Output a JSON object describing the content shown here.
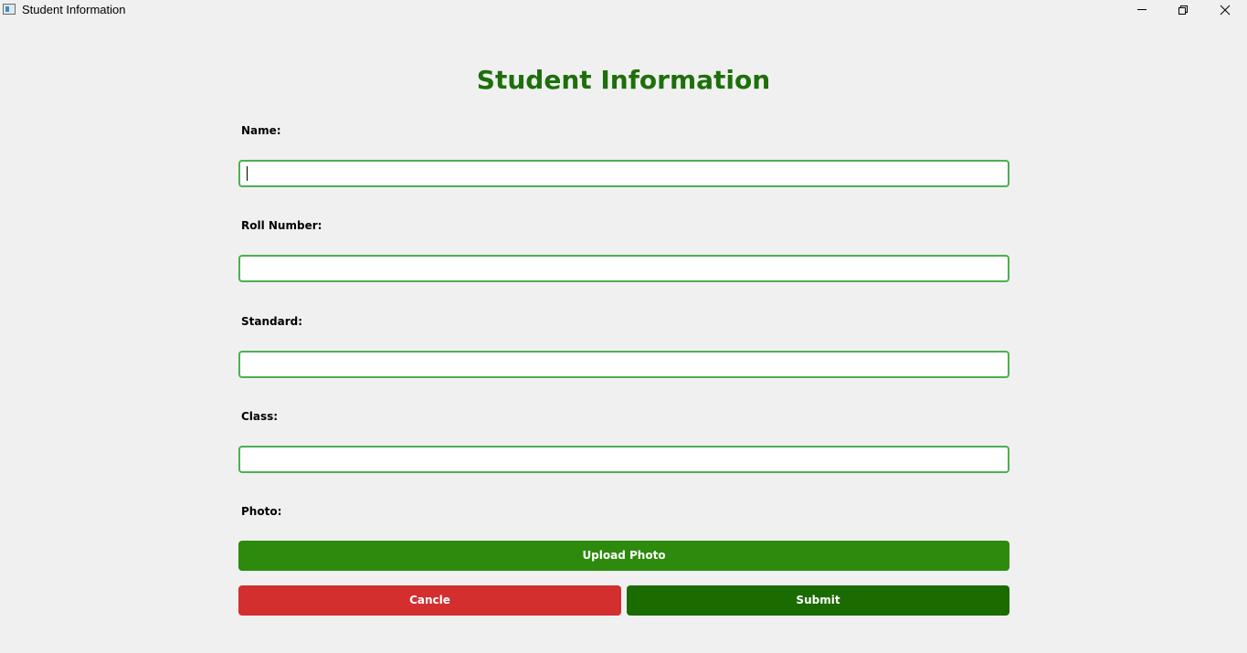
{
  "window": {
    "title": "Student Information"
  },
  "form": {
    "title": "Student Information",
    "fields": [
      {
        "label": "Name:",
        "value": ""
      },
      {
        "label": "Roll Number:",
        "value": ""
      },
      {
        "label": "Standard:",
        "value": ""
      },
      {
        "label": "Class:",
        "value": ""
      }
    ],
    "photo_label": "Photo:",
    "upload_label": "Upload Photo",
    "cancel_label": "Cancle",
    "submit_label": "Submit"
  },
  "colors": {
    "title": "#1d6f0a",
    "input_border": "#4caf50",
    "upload_button": "#2d8a0c",
    "cancel_button": "#d32f2f",
    "submit_button": "#1a6b00"
  },
  "icons": [
    "app-icon",
    "minimize-icon",
    "maximize-icon",
    "close-icon"
  ]
}
